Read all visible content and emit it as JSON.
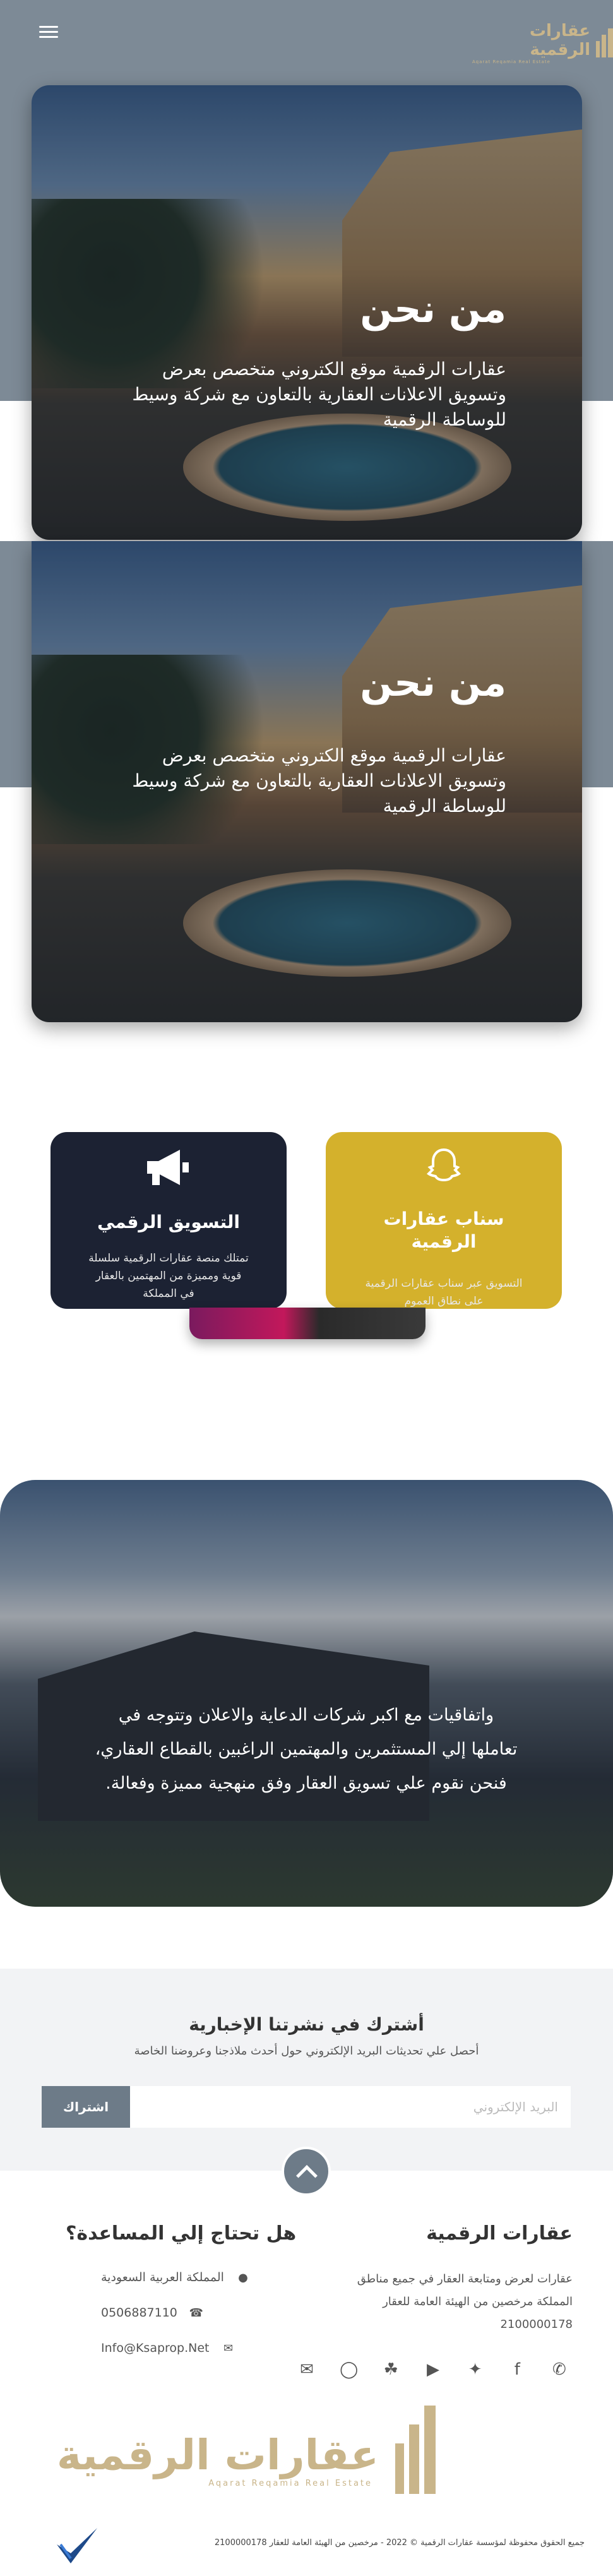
{
  "header": {
    "logo_text": "عقارات الرقمية",
    "logo_sub": "Aqarat Reqamia Real Estate",
    "menu_icon": "hamburger-icon"
  },
  "hero": [
    {
      "title": "من نحن",
      "text": "عقارات الرقمية موقع الكتروني متخصص بعرض وتسويق الاعلانات العقارية بالتعاون مع شركة وسيط للوساطة الرقمية"
    },
    {
      "title": "من نحن",
      "text": "عقارات الرقمية موقع الكتروني متخصص بعرض وتسويق الاعلانات العقارية بالتعاون مع شركة وسيط للوساطة الرقمية"
    }
  ],
  "services": [
    {
      "title": "سناب عقارات الرقمية",
      "text": "التسويق عبر سناب عقارات الرقمية على نطاق العموم",
      "icon": "snapchat-icon"
    },
    {
      "title": "التسويق الرقمي",
      "text": "تمتلك منصة عقارات الرقمية سلسلة قوية ومميزة من المهتمين بالعقار في المملكة",
      "icon": "megaphone-icon"
    }
  ],
  "about": {
    "partial_text": "واتفاقيات مع اكبر شركات الدعاية والاعلان وتتوجه في تعاملها إلي المستثمرين والمهتمين الراغبين بالقطاع العقاري، فنحن نقوم علي تسويق العقار وفق منهجية مميزة وفعالة."
  },
  "newsletter": {
    "title": "أشترك في نشرتنا الإخبارية",
    "subtitle": "أحصل علي تحديثات البريد الإلكتروني حول أحدث ملاذجنا وعروضنا الخاصة",
    "placeholder": "البريد الإلكتروني",
    "button": "اشتراك"
  },
  "footer": {
    "about_title": "عقارات الرقمية",
    "about_text": "عقارات لعرض ومتابعة العقار في جميع مناطق المملكة مرخصين من الهيئة العامة للعقار 2100000178",
    "help_title": "هل تحتاج إلي المساعدة؟",
    "contact": [
      {
        "icon": "location-icon",
        "value": "المملكة العربية السعودية"
      },
      {
        "icon": "phone-icon",
        "value": "0506887110"
      },
      {
        "icon": "email-icon",
        "value": "Info@Ksaprop.Net"
      }
    ],
    "socials": [
      "whatsapp-icon",
      "facebook-icon",
      "twitter-icon",
      "youtube-icon",
      "snapchat-icon",
      "instagram-icon",
      "mail-open-icon"
    ],
    "logo_text": "عقارات الرقمية",
    "logo_sub": "Aqarat Reqamia Real Estate",
    "copyright": "جميع الحقوق محفوظة لمؤسسة عقارات الرقمية © 2022 - مرخصين من الهيئة العامة للعقار 2100000178"
  },
  "colors": {
    "header_bg": "#7d8a96",
    "gold": "#c9b58a",
    "button_gray": "#6d7b88"
  }
}
